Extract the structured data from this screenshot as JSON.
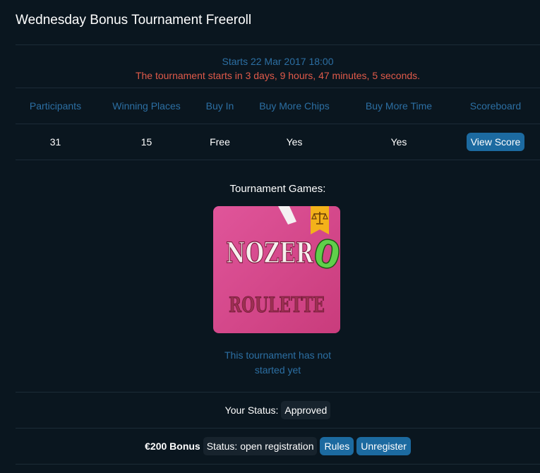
{
  "page": {
    "title": "Wednesday Bonus Tournament Freeroll"
  },
  "schedule": {
    "starts": "Starts 22 Mar 2017 18:00",
    "countdown": "The tournament starts in 3 days, 9 hours, 47 minutes, 5 seconds."
  },
  "table": {
    "headers": [
      "Participants",
      "Winning Places",
      "Buy In",
      "Buy More Chips",
      "Buy More Time",
      "Scoreboard"
    ],
    "values": [
      "31",
      "15",
      "Free",
      "Yes",
      "Yes"
    ],
    "view_score_label": "View Score"
  },
  "games": {
    "title": "Tournament Games:",
    "tile": {
      "line1": "NOZER",
      "zero_char": "0",
      "line2": "ROULETTE",
      "badge_icon": "scales-icon"
    },
    "not_started": "This tournament has not started yet"
  },
  "status": {
    "label": "Your Status:",
    "value": "Approved"
  },
  "bonus": {
    "name": "€200 Bonus",
    "status": "Status: open registration",
    "rules_label": "Rules",
    "unregister_label": "Unregister"
  },
  "colors": {
    "background": "#0a161f",
    "accent_blue": "#2c6fa3",
    "button_blue": "#1c6aa0",
    "countdown_red": "#e05a4a",
    "tile_pink": "#d8488a"
  }
}
